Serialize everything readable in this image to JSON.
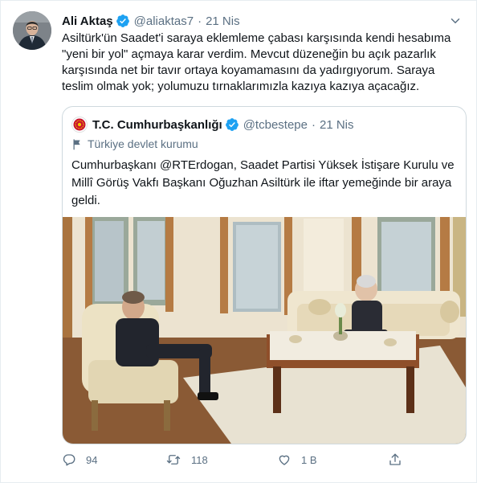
{
  "tweet": {
    "author_name": "Ali Aktaş",
    "handle": "@aliaktas7",
    "separator": "·",
    "time": "21 Nis",
    "text": "Asiltürk'ün Saadet'i saraya eklemleme çabası karşısında kendi hesabıma \"yeni bir yol\" açmaya karar verdim. Mevcut düzeneğin bu açık pazarlık karşısında net bir tavır ortaya koyamamasını da yadırgıyorum. Saraya teslim olmak yok; yolumuzu tırnaklarımızla kazıya kazıya açacağız.",
    "icons": {
      "verified": "verified-badge-icon",
      "more": "more-options-icon"
    }
  },
  "quoted": {
    "author_name": "T.C. Cumhurbaşkanlığı",
    "handle": "@tcbestepe",
    "separator": "·",
    "time": "21 Nis",
    "label": "Türkiye devlet kurumu",
    "text": "Cumhurbaşkanı @RTErdogan, Saadet Partisi Yüksek İstişare Kurulu ve Millî Görüş Vakfı Başkanı Oğuzhan Asiltürk ile iftar yemeğinde bir araya geldi.",
    "icons": {
      "label": "flag-icon",
      "avatar": "presidential-seal-icon"
    }
  },
  "actions": {
    "reply": {
      "count": "94",
      "icon": "reply-icon"
    },
    "retweet": {
      "count": "118",
      "icon": "retweet-icon"
    },
    "like": {
      "count": "1 B",
      "icon": "like-icon"
    },
    "share": {
      "icon": "share-icon"
    }
  },
  "colors": {
    "accent": "#1da1f2",
    "secondary_text": "#5b7083",
    "border": "#cfd9de"
  }
}
